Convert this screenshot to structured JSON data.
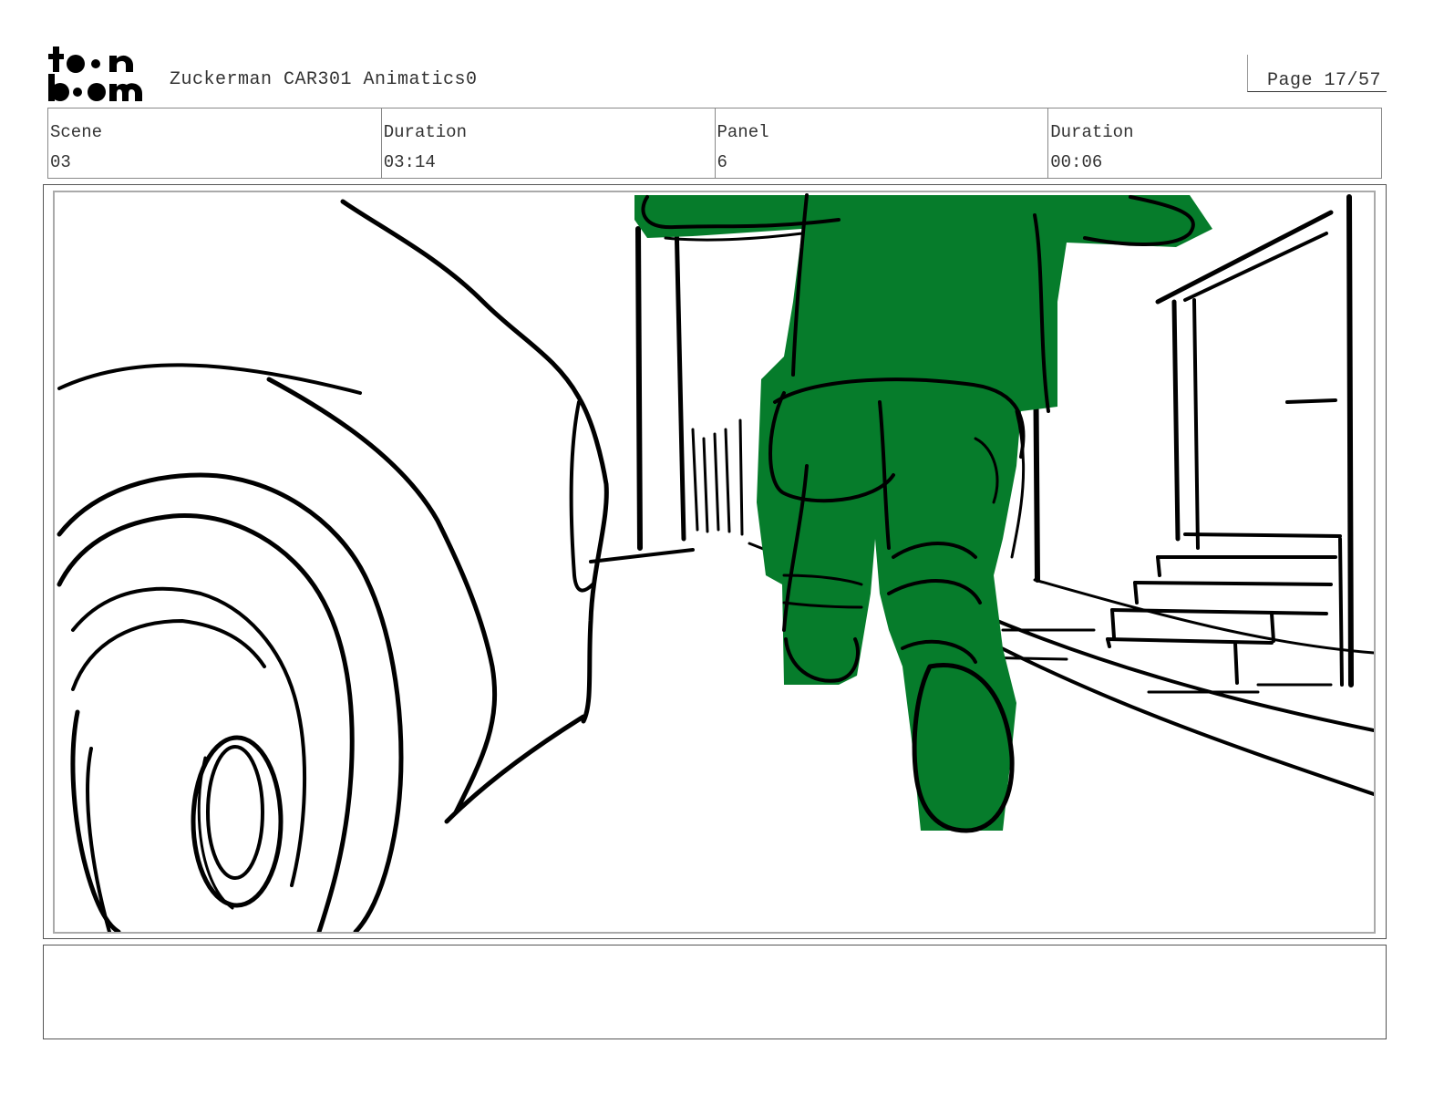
{
  "header": {
    "logo_text": "toon boom",
    "title": "Zuckerman CAR301 Animatics0",
    "page": "Page 17/57"
  },
  "info": {
    "scene_label": "Scene",
    "scene_value": "03",
    "duration_label": "Duration",
    "duration_value": "03:14",
    "panel_label": "Panel",
    "panel_value": "6",
    "panel_duration_label": "Duration",
    "panel_duration_value": "00:06"
  },
  "colors": {
    "character_fill": "#067c2b",
    "ink": "#000000"
  },
  "notes": {
    "action": ""
  }
}
